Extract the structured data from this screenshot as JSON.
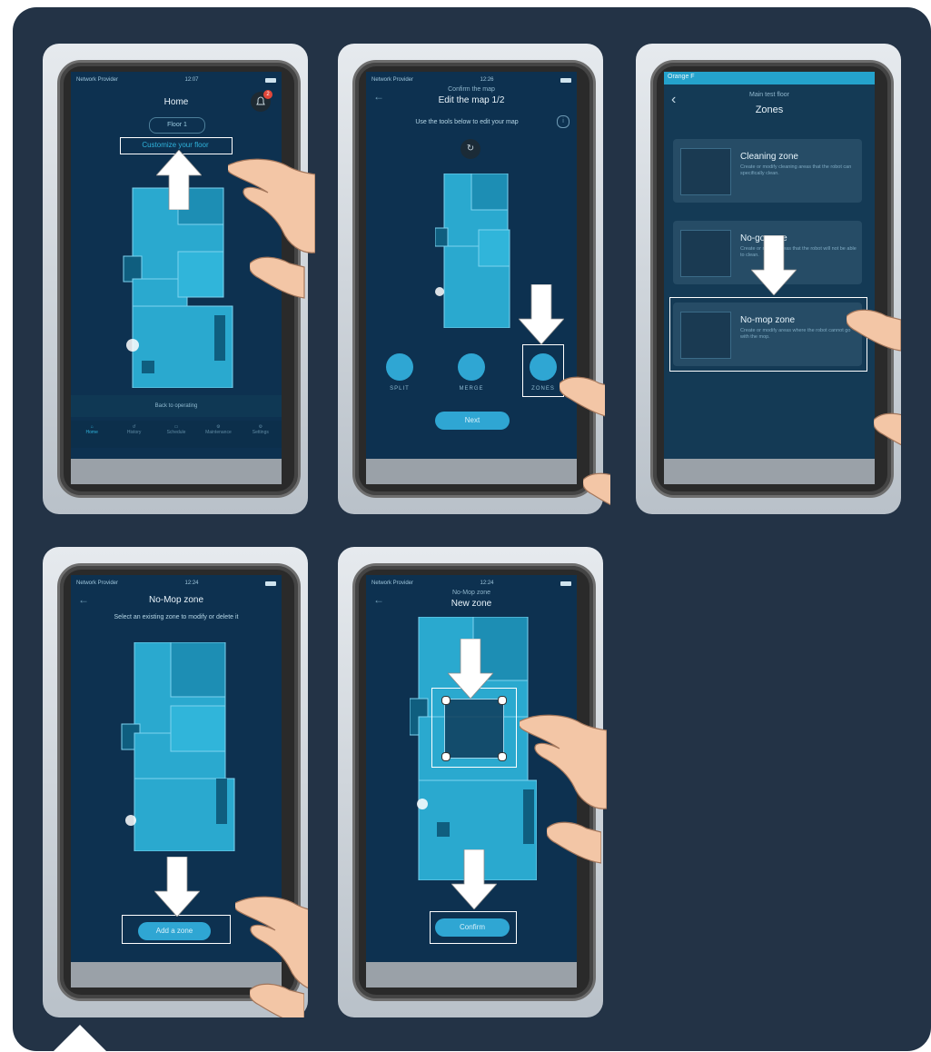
{
  "colors": {
    "panel": "#233346",
    "screen": "#0d3150",
    "accent": "#2fa6d3",
    "map": "#2aa9cf"
  },
  "step1": {
    "status_left": "Network Provider",
    "time": "12:07",
    "title": "Home",
    "badge": "2",
    "floor_selector": "Floor 1",
    "customize_link": "Customize your floor",
    "clean_status": "Back to operating",
    "tabs": [
      {
        "label": "Home",
        "icon": "home-icon"
      },
      {
        "label": "History",
        "icon": "history-icon"
      },
      {
        "label": "Schedule",
        "icon": "calendar-icon"
      },
      {
        "label": "Maintenance",
        "icon": "maintenance-icon"
      },
      {
        "label": "Settings",
        "icon": "gear-icon"
      }
    ]
  },
  "step2": {
    "status_left": "Network Provider",
    "time": "12:26",
    "subtitle": "Confirm the map",
    "title": "Edit the map 1/2",
    "instruction": "Use the tools below to edit your map",
    "tools": [
      {
        "label": "SPLIT",
        "icon": "split-icon"
      },
      {
        "label": "MERGE",
        "icon": "merge-icon"
      },
      {
        "label": "ZONES",
        "icon": "zones-icon"
      }
    ],
    "next_button": "Next"
  },
  "step3": {
    "status_left": "Orange F",
    "subtitle": "Main test floor",
    "title": "Zones",
    "zones": [
      {
        "title": "Cleaning zone",
        "desc": "Create or modify cleaning areas that the robot can specifically clean.",
        "icon": "cleaning-zone-icon"
      },
      {
        "title": "No-go zone",
        "desc": "Create or modify areas that the robot will not be able to clean.",
        "icon": "no-go-zone-icon"
      },
      {
        "title": "No-mop zone",
        "desc": "Create or modify areas where the robot cannot go with the mop.",
        "icon": "no-mop-zone-icon"
      }
    ]
  },
  "step4": {
    "status_left": "Network Provider",
    "time": "12:24",
    "title": "No-Mop zone",
    "instruction": "Select an existing zone to modify or delete it",
    "add_button": "Add a zone"
  },
  "step5": {
    "status_left": "Network Provider",
    "time": "12:24",
    "subtitle": "No-Mop zone",
    "title": "New zone",
    "confirm_button": "Confirm"
  }
}
